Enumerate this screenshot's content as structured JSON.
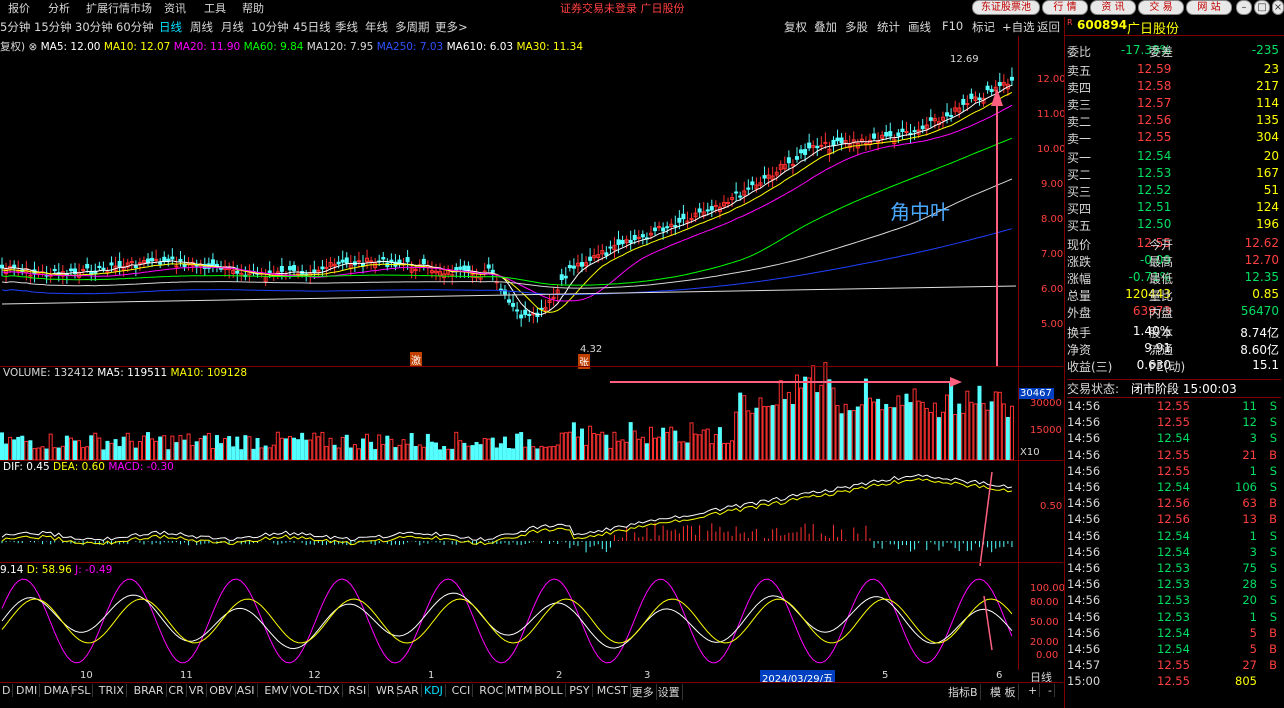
{
  "menu": [
    "报价",
    "分析",
    "扩展行情市场",
    "资讯",
    "工具",
    "帮助"
  ],
  "top_notice": "证券交易未登录  广日股份",
  "top_buttons": [
    "东证股票池",
    "行 情",
    "资 讯",
    "交 易",
    "网 站"
  ],
  "periods": [
    "5分钟",
    "15分钟",
    "30分钟",
    "60分钟",
    "日线",
    "周线",
    "月线",
    "10分钟",
    "45日线",
    "季线",
    "年线",
    "多周期",
    "更多>"
  ],
  "active_period": "日线",
  "tools": [
    "复权",
    "叠加",
    "多股",
    "统计",
    "画线",
    "F10",
    "标记",
    "+自选",
    "返回"
  ],
  "ma_legend": {
    "prefix": "复权)",
    "ma5": "MA5: 12.00",
    "ma10": "MA10: 12.07",
    "ma20": "MA20: 11.90",
    "ma60": "MA60: 9.84",
    "ma120": "MA120: 7.95",
    "ma250": "MA250: 7.03",
    "ma610": "MA610: 6.03",
    "ma30": "MA30: 11.34"
  },
  "price_axis": [
    "12.00",
    "11.00",
    "10.00",
    "9.00",
    "8.00",
    "7.00",
    "6.00",
    "5.00"
  ],
  "annotation": {
    "high": "12.69",
    "low": "4.32",
    "text": "角中叶",
    "mark1": "激",
    "mark2": "张"
  },
  "volume_legend": {
    "vol": "VOLUME: 132412",
    "ma5": "MA5: 119511",
    "ma10": "MA10: 109128"
  },
  "volume_axis": {
    "box": "30467",
    "top": "30000",
    "mid": "15000",
    "unit": "X10"
  },
  "macd_legend": {
    "dif": "DIF: 0.45",
    "dea": "DEA: 0.60",
    "macd": "MACD: -0.30"
  },
  "macd_axis": "0.50",
  "kdj_legend": {
    "k": "9.14",
    "d": "D: 58.96",
    "j": "J: -0.49"
  },
  "kdj_axis": [
    "100.00",
    "80.00",
    "50.00",
    "20.00",
    "0.00"
  ],
  "x_axis": [
    "10",
    "11",
    "12",
    "1",
    "2",
    "3",
    "2024/03/29/五",
    "5",
    "6"
  ],
  "x_unit": "日线",
  "indicators": [
    "D",
    "DMI",
    "DMA",
    "FSL",
    "TRIX",
    "BRAR",
    "CR",
    "VR",
    "OBV",
    "ASI",
    "EMV",
    "VOL-TDX",
    "RSI",
    "WR",
    "SAR",
    "KDJ",
    "CCI",
    "ROC",
    "MTM",
    "BOLL",
    "PSY",
    "MCST",
    "更多",
    "设置"
  ],
  "active_indicator": "KDJ",
  "bottom_right": [
    "指标B",
    "模 板",
    "+",
    "-"
  ],
  "stock": {
    "code": "600894",
    "name": "广日股份"
  },
  "weibi": {
    "label": "委比",
    "value": "-17.39%",
    "label2": "委差",
    "value2": "-235"
  },
  "asks": [
    {
      "label": "卖五",
      "price": "12.59",
      "vol": "23"
    },
    {
      "label": "卖四",
      "price": "12.58",
      "vol": "217"
    },
    {
      "label": "卖三",
      "price": "12.57",
      "vol": "114"
    },
    {
      "label": "卖二",
      "price": "12.56",
      "vol": "135"
    },
    {
      "label": "卖一",
      "price": "12.55",
      "vol": "304"
    }
  ],
  "bids": [
    {
      "label": "买一",
      "price": "12.54",
      "vol": "20"
    },
    {
      "label": "买二",
      "price": "12.53",
      "vol": "167"
    },
    {
      "label": "买三",
      "price": "12.52",
      "vol": "51"
    },
    {
      "label": "买四",
      "price": "12.51",
      "vol": "124"
    },
    {
      "label": "买五",
      "price": "12.50",
      "vol": "196"
    }
  ],
  "quote": [
    {
      "l1": "现价",
      "v1": "12.55",
      "c1": "red",
      "l2": "今开",
      "v2": "12.62",
      "c2": "red"
    },
    {
      "l1": "涨跌",
      "v1": "-0.09",
      "c1": "green",
      "l2": "最高",
      "v2": "12.70",
      "c2": "red"
    },
    {
      "l1": "涨幅",
      "v1": "-0.71%",
      "c1": "green",
      "l2": "最低",
      "v2": "12.35",
      "c2": "green"
    },
    {
      "l1": "总量",
      "v1": "120443",
      "c1": "yel",
      "l2": "量比",
      "v2": "0.85",
      "c2": "yel"
    },
    {
      "l1": "外盘",
      "v1": "63973",
      "c1": "red",
      "l2": "内盘",
      "v2": "56470",
      "c2": "green"
    }
  ],
  "finance": [
    {
      "l1": "换手",
      "v1": "1.40%",
      "l2": "股本",
      "v2": "8.74亿"
    },
    {
      "l1": "净资",
      "v1": "9.91",
      "l2": "流通",
      "v2": "8.60亿"
    },
    {
      "l1": "收益(三)",
      "v1": "0.630",
      "l2": "PE(动)",
      "v2": "15.1"
    }
  ],
  "trade_status": {
    "label": "交易状态:",
    "value": "闭市阶段 15:00:03"
  },
  "ticks": [
    {
      "t": "14:56",
      "p": "12.55",
      "pc": "red",
      "v": "11",
      "bs": "S"
    },
    {
      "t": "14:56",
      "p": "12.55",
      "pc": "red",
      "v": "12",
      "bs": "S"
    },
    {
      "t": "14:56",
      "p": "12.54",
      "pc": "green",
      "v": "3",
      "bs": "S"
    },
    {
      "t": "14:56",
      "p": "12.55",
      "pc": "red",
      "v": "21",
      "bs": "B"
    },
    {
      "t": "14:56",
      "p": "12.55",
      "pc": "red",
      "v": "1",
      "bs": "S"
    },
    {
      "t": "14:56",
      "p": "12.54",
      "pc": "green",
      "v": "106",
      "bs": "S"
    },
    {
      "t": "14:56",
      "p": "12.56",
      "pc": "red",
      "v": "63",
      "bs": "B"
    },
    {
      "t": "14:56",
      "p": "12.56",
      "pc": "red",
      "v": "13",
      "bs": "B"
    },
    {
      "t": "14:56",
      "p": "12.54",
      "pc": "green",
      "v": "1",
      "bs": "S"
    },
    {
      "t": "14:56",
      "p": "12.54",
      "pc": "green",
      "v": "3",
      "bs": "S"
    },
    {
      "t": "14:56",
      "p": "12.53",
      "pc": "green",
      "v": "75",
      "bs": "S"
    },
    {
      "t": "14:56",
      "p": "12.53",
      "pc": "green",
      "v": "28",
      "bs": "S"
    },
    {
      "t": "14:56",
      "p": "12.53",
      "pc": "green",
      "v": "20",
      "bs": "S"
    },
    {
      "t": "14:56",
      "p": "12.53",
      "pc": "green",
      "v": "1",
      "bs": "S"
    },
    {
      "t": "14:56",
      "p": "12.54",
      "pc": "green",
      "v": "5",
      "bs": "B"
    },
    {
      "t": "14:56",
      "p": "12.54",
      "pc": "green",
      "v": "5",
      "bs": "B"
    },
    {
      "t": "14:57",
      "p": "12.55",
      "pc": "red",
      "v": "27",
      "bs": "B"
    },
    {
      "t": "15:00",
      "p": "12.55",
      "pc": "red",
      "v": "805",
      "bs": ""
    }
  ]
}
